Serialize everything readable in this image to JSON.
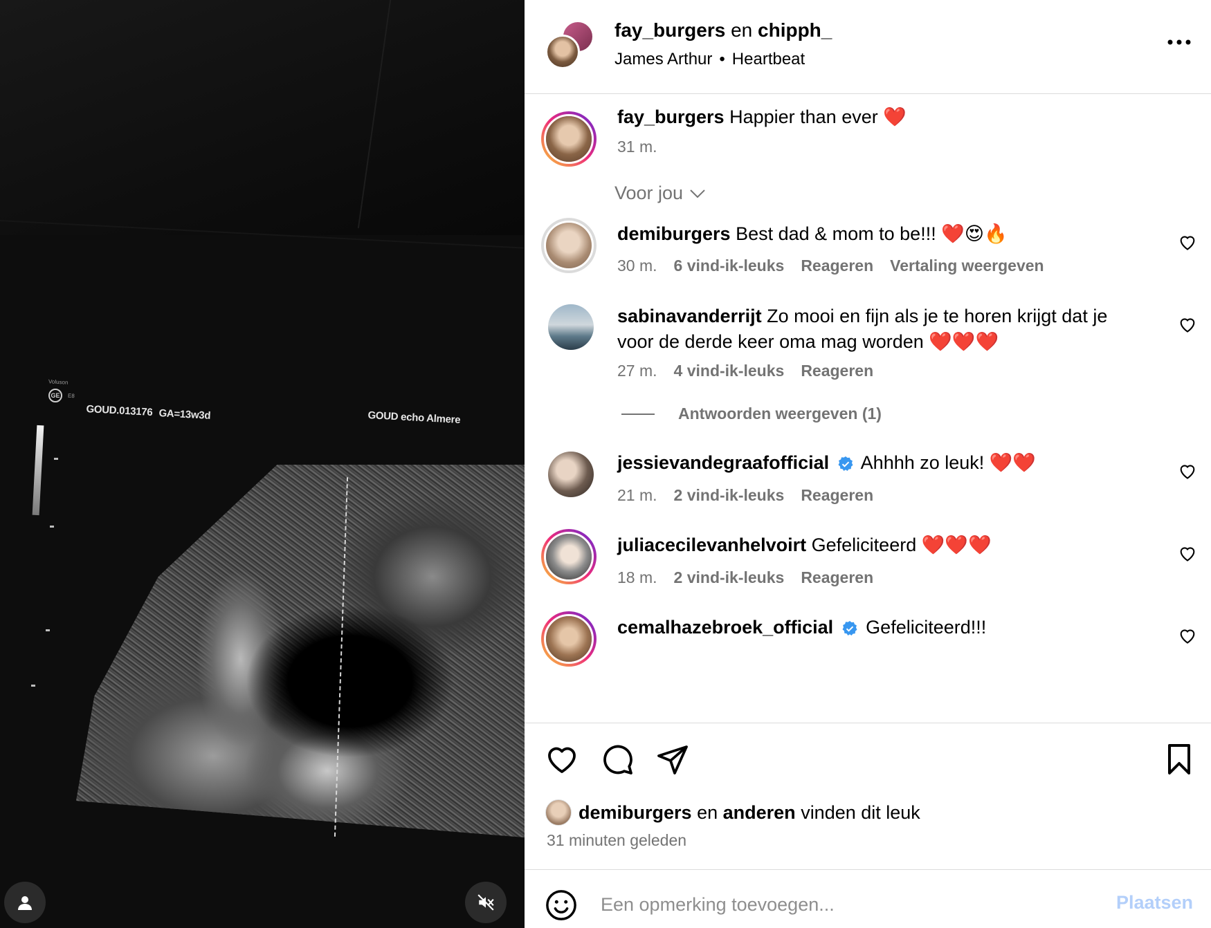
{
  "media": {
    "scan_labels": {
      "patient_id": "GOUD.013176",
      "gestational_age": "GA=13w3d",
      "clinic": "GOUD echo Almere",
      "device": "Voluson",
      "probe": "E8",
      "brand": "GE"
    },
    "buttons": {
      "profile_icon": "person-icon",
      "mute_icon": "speaker-muted-icon"
    }
  },
  "header": {
    "user1": "fay_burgers",
    "connector": "en",
    "user2": "chipph_",
    "artist": "James Arthur",
    "separator": "•",
    "song": "Heartbeat",
    "more_label": "..."
  },
  "caption": {
    "username": "fay_burgers",
    "text": "Happier than ever ❤️",
    "time": "31 m."
  },
  "filter": {
    "label": "Voor jou"
  },
  "comments": [
    {
      "username": "demiburgers",
      "verified": false,
      "text": "Best dad & mom to be!!! ❤️😍🔥",
      "time": "30 m.",
      "likes": "6 vind-ik-leuks",
      "reply": "Reageren",
      "translate": "Vertaling weergeven"
    },
    {
      "username": "sabinavanderrijt",
      "verified": false,
      "text": "Zo mooi en fijn als je te horen krijgt dat je voor de derde keer oma mag worden ❤️❤️❤️",
      "time": "27 m.",
      "likes": "4 vind-ik-leuks",
      "reply": "Reageren"
    },
    {
      "username": "jessievandegraafofficial",
      "verified": true,
      "text": "Ahhhh zo leuk! ❤️❤️",
      "time": "21 m.",
      "likes": "2 vind-ik-leuks",
      "reply": "Reageren"
    },
    {
      "username": "juliacecilevanhelvoirt",
      "verified": false,
      "text": "Gefeliciteerd ❤️❤️❤️",
      "time": "18 m.",
      "likes": "2 vind-ik-leuks",
      "reply": "Reageren"
    },
    {
      "username": "cemalhazebroek_official",
      "verified": true,
      "text": "Gefeliciteerd!!!"
    }
  ],
  "view_replies": "Antwoorden weergeven (1)",
  "likes_summary": {
    "user": "demiburgers",
    "connector": "en",
    "others": "anderen",
    "suffix": "vinden dit leuk"
  },
  "timestamp": "31 minuten geleden",
  "composer": {
    "placeholder": "Een opmerking toevoegen...",
    "post_label": "Plaatsen"
  },
  "colors": {
    "link_disabled": "#b3cffa",
    "secondary_text": "#737373",
    "verified_blue": "#3897f0",
    "divider": "#dbdbdb"
  }
}
